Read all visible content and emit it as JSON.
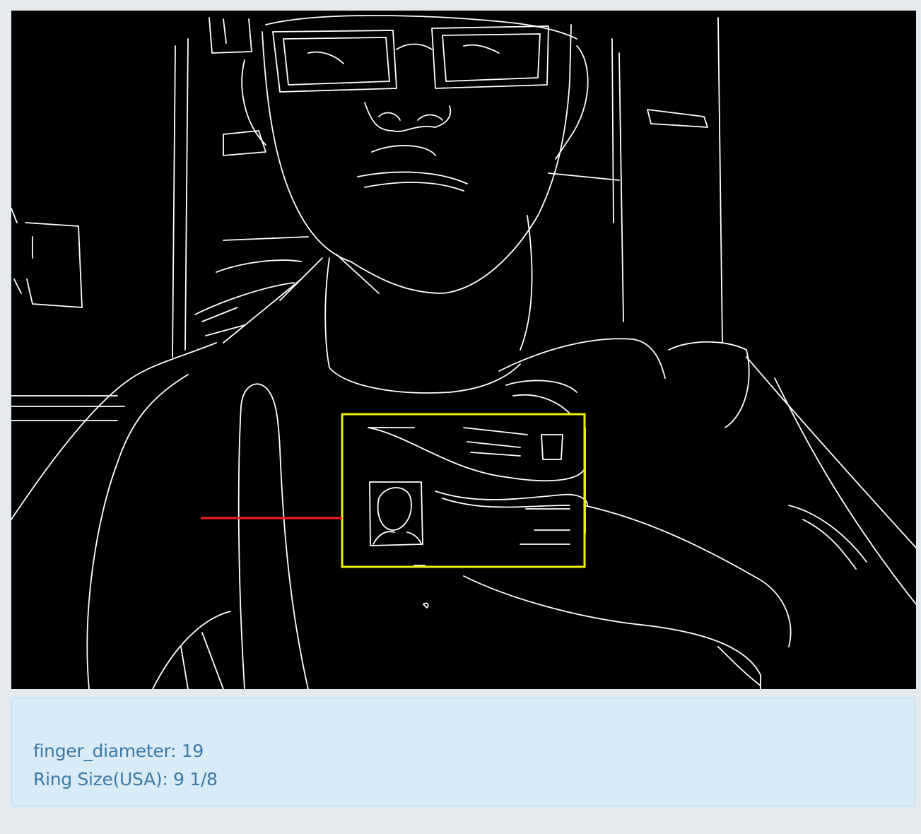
{
  "result": {
    "finger_diameter_line": "finger_diameter: 19",
    "ring_size_line": "Ring Size(USA): 9 1/8"
  },
  "overlay": {
    "card_box_color": "#f2f000",
    "finger_line_color": "#ff1a1a",
    "edge_color": "#ffffff"
  }
}
